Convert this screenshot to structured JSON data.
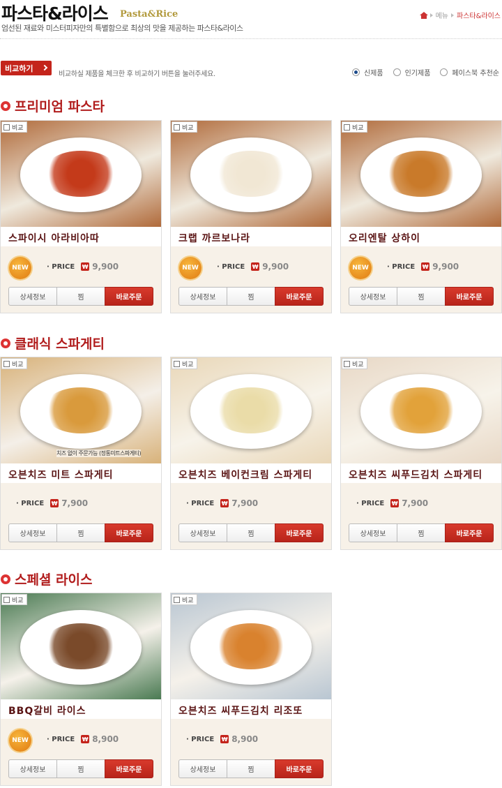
{
  "header": {
    "title_ko": "파스타&라이스",
    "title_en": "Pasta&Rice",
    "subtitle": "엄선된 재료와 미스터피자만의 특별함으로 최상의 맛을 제공하는 파스타&라이스",
    "breadcrumb": {
      "menu": "메뉴",
      "current": "파스타&라이스"
    }
  },
  "compare": {
    "button_label": "비교하기",
    "hint": "비교하실 제품을 체크한 후 비교하기 버튼을 눌러주세요.",
    "sort_options": [
      {
        "label": "신제품",
        "selected": true
      },
      {
        "label": "인기제품",
        "selected": false
      },
      {
        "label": "페이스북 추천순",
        "selected": false
      }
    ]
  },
  "card_labels": {
    "compare": "비교",
    "price": "· PRICE",
    "won": "₩",
    "new": "NEW",
    "detail": "상세정보",
    "wish": "찜",
    "order": "바로주문"
  },
  "sections": [
    {
      "title": "프리미엄 파스타",
      "items": [
        {
          "name": "스파이시 아라비아따",
          "price": "9,900",
          "is_new": true
        },
        {
          "name": "크랩 까르보나라",
          "price": "9,900",
          "is_new": true
        },
        {
          "name": "오리엔탈 상하이",
          "price": "9,900",
          "is_new": true
        }
      ]
    },
    {
      "title": "클래식 스파게티",
      "items": [
        {
          "name": "오븐치즈 미트 스파게티",
          "price": "7,900",
          "is_new": false,
          "photo_caption": "치즈 없이 주문가능 (정통미트스파게티)"
        },
        {
          "name": "오븐치즈 베이컨크림 스파게티",
          "price": "7,900",
          "is_new": false
        },
        {
          "name": "오븐치즈 씨푸드김치 스파게티",
          "price": "7,900",
          "is_new": false
        }
      ]
    },
    {
      "title": "스페셜 라이스",
      "items": [
        {
          "name": "BBQ갈비 라이스",
          "price": "8,900",
          "is_new": true
        },
        {
          "name": "오븐치즈 씨푸드김치 리조또",
          "price": "8,900",
          "is_new": false
        }
      ]
    }
  ],
  "colors": {
    "accent": "#c4241b",
    "section_title": "#b11c1c",
    "card_bg": "#f7f1e8"
  }
}
